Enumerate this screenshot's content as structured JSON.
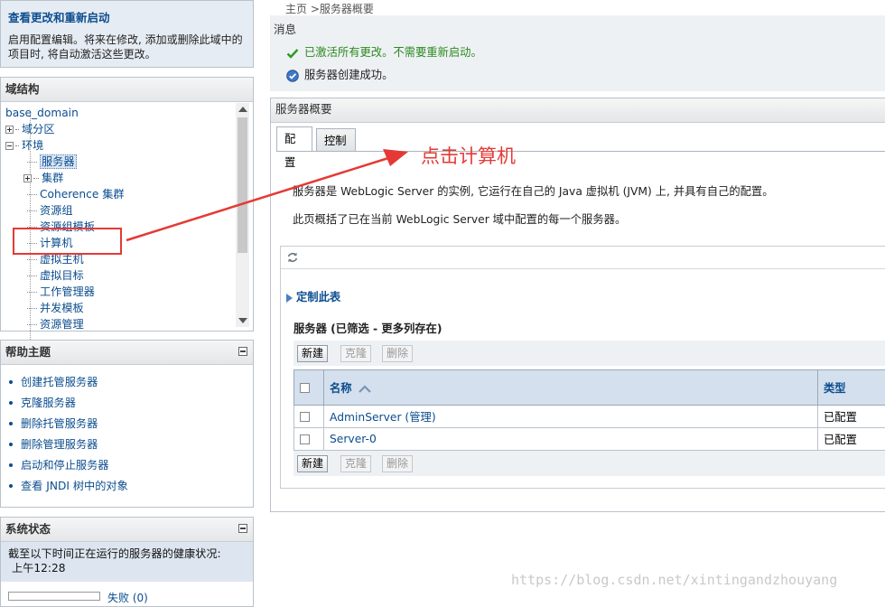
{
  "changes": {
    "title": "查看更改和重新启动",
    "description": "启用配置编辑。将来在修改, 添加或删除此域中的项目时, 将自动激活这些更改。"
  },
  "domain_panel": {
    "title": "域结构",
    "tree": [
      {
        "label": "base_domain"
      },
      {
        "label": "域分区"
      },
      {
        "label": "环境"
      },
      {
        "label": "服务器"
      },
      {
        "label": "集群"
      },
      {
        "label": "Coherence 集群"
      },
      {
        "label": "资源组"
      },
      {
        "label": "资源组模板"
      },
      {
        "label": "计算机"
      },
      {
        "label": "虚拟主机"
      },
      {
        "label": "虚拟目标"
      },
      {
        "label": "工作管理器"
      },
      {
        "label": "并发模板"
      },
      {
        "label": "资源管理"
      }
    ]
  },
  "help_panel": {
    "title": "帮助主题",
    "items": [
      "创建托管服务器",
      "克隆服务器",
      "删除托管服务器",
      "删除管理服务器",
      "启动和停止服务器",
      "查看 JNDI 树中的对象"
    ]
  },
  "status_panel": {
    "title": "系统状态",
    "text": "截至以下时间正在运行的服务器的健康状况:",
    "time": "上午12:28",
    "failed": "失败 (0)"
  },
  "breadcrumb": {
    "home": "主页",
    "sep": ">",
    "current": "服务器概要"
  },
  "messages": {
    "title": "消息",
    "ok": "已激活所有更改。不需要重新启动。",
    "info": "服务器创建成功。"
  },
  "summary": {
    "title": "服务器概要",
    "tabs": [
      "配置",
      "控制"
    ],
    "intro1": "服务器是 WebLogic Server 的实例, 它运行在自己的 Java 虚拟机 (JVM) 上, 并具有自己的配置。",
    "intro2": "此页概括了已在当前 WebLogic Server 域中配置的每一个服务器。",
    "customize": "定制此表",
    "table_title": "服务器 (已筛选 - 更多列存在)",
    "buttons": {
      "new": "新建",
      "clone": "克隆",
      "delete": "删除"
    },
    "columns": [
      "名称",
      "类型"
    ],
    "rows": [
      {
        "name": "AdminServer (管理)",
        "type": "已配置"
      },
      {
        "name": "Server-0",
        "type": "已配置"
      }
    ]
  },
  "annotation": {
    "text": "点击计算机",
    "color": "#e53935"
  },
  "watermark": "https://blog.csdn.net/xintingandzhouyang"
}
